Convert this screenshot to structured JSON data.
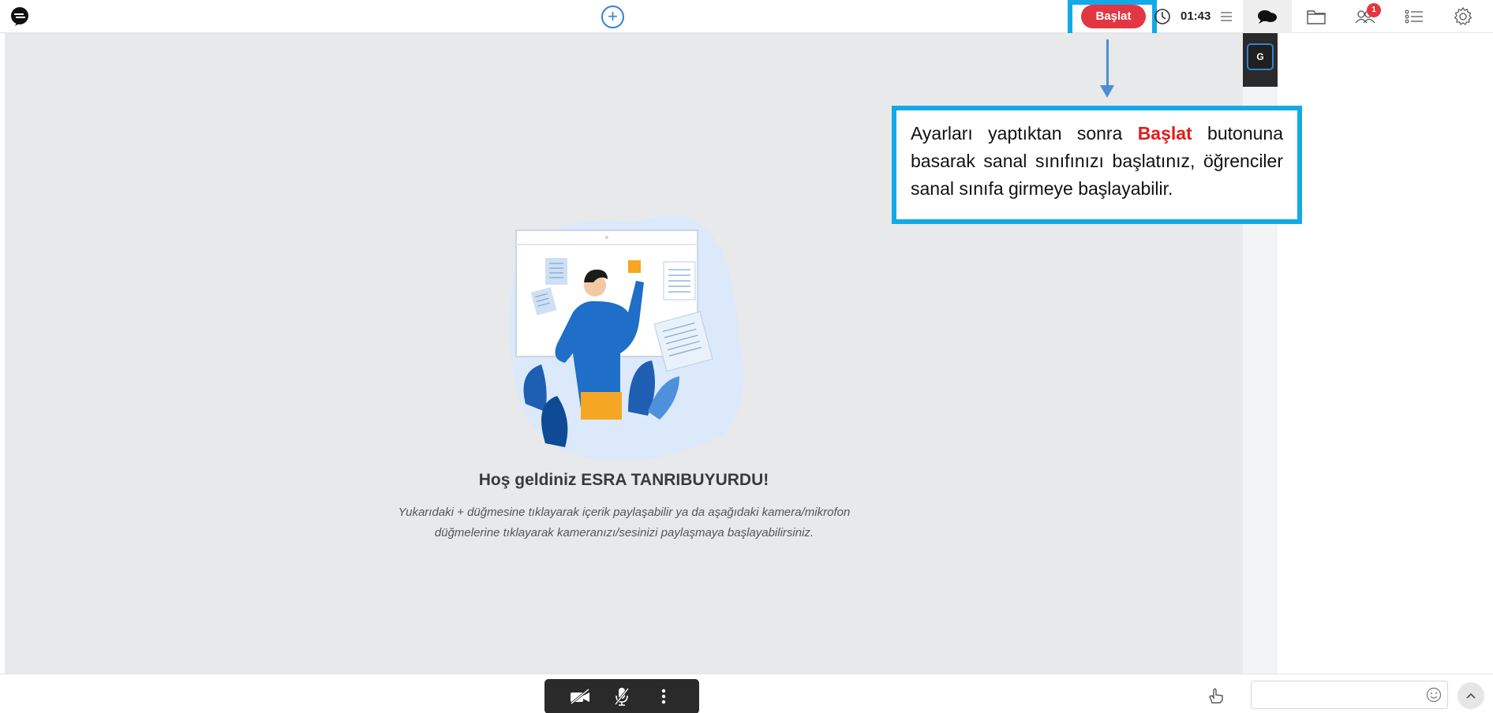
{
  "topbar": {
    "start_label": "Başlat",
    "timer": "01:43"
  },
  "right_tabs": [
    {
      "icon": "chat-icon",
      "active": true
    },
    {
      "icon": "folder-icon"
    },
    {
      "icon": "users-icon",
      "badge": "1"
    },
    {
      "icon": "list-icon"
    },
    {
      "icon": "gear-icon"
    }
  ],
  "stage": {
    "welcome_prefix": "Hoş geldiniz ",
    "user_name": "ESRA TANRIBUYURDU",
    "welcome_suffix": "!",
    "description": "Yukarıdaki + düğmesine tıklayarak içerik paylaşabilir ya da aşağıdaki kamera/mikrofon düğmelerine tıklayarak kameranızı/sesinizi paylaşmaya başlayabilirsiniz."
  },
  "participants": [
    {
      "initial": "G"
    }
  ],
  "callout": {
    "text_before": "Ayarları yaptıktan sonra ",
    "highlight": "Başlat",
    "text_after": " butonuna basarak sanal sınıfınızı başlatınız, öğrenciler sanal sınıfa girmeye başlayabilir."
  },
  "chat": {
    "input_value": "",
    "input_placeholder": ""
  },
  "colors": {
    "accent_blue": "#2f82d6",
    "start_red": "#e23743",
    "callout_border": "#13a9e7",
    "callout_highlight": "#e21b1b"
  }
}
